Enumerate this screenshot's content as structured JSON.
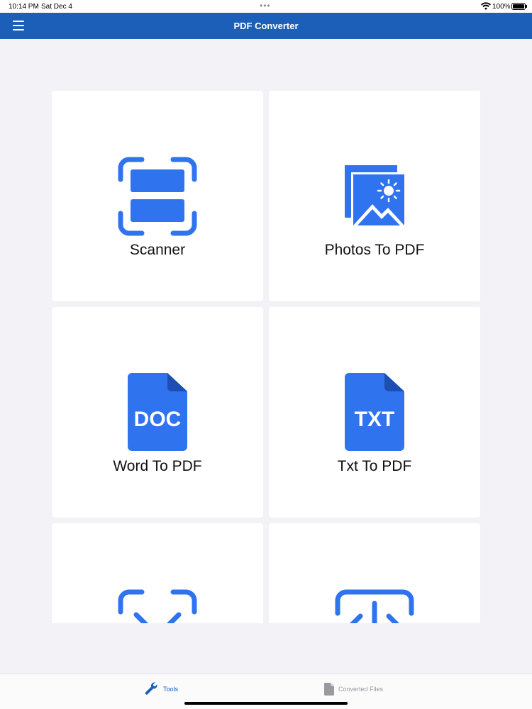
{
  "status_bar": {
    "time": "10:14 PM",
    "date": "Sat Dec 4",
    "battery": "100%"
  },
  "header": {
    "title": "PDF Converter"
  },
  "tools": [
    {
      "label": "Scanner",
      "icon": "scanner-icon"
    },
    {
      "label": "Photos To PDF",
      "icon": "photos-icon"
    },
    {
      "label": "Word To PDF",
      "icon": "doc-file-icon",
      "badge": "DOC"
    },
    {
      "label": "Txt To PDF",
      "icon": "txt-file-icon",
      "badge": "TXT"
    },
    {
      "label": "",
      "icon": "fullscreen-icon"
    },
    {
      "label": "",
      "icon": "upload-icon"
    }
  ],
  "tab_bar": {
    "items": [
      {
        "label": "Tools",
        "icon": "wrench-icon",
        "active": true
      },
      {
        "label": "Converted Files",
        "icon": "document-icon",
        "active": false
      }
    ]
  },
  "colors": {
    "accent": "#1b5fb8",
    "icon_blue": "#2f74ee",
    "background": "#f2f2f7"
  }
}
